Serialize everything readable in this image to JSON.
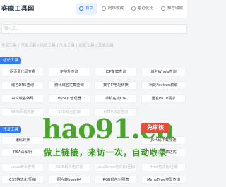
{
  "header": {
    "brand": "客鹿工具网",
    "nav": [
      {
        "label": "首页",
        "active": true
      },
      {
        "label": "网络收藏",
        "active": false
      },
      {
        "label": "最近使用",
        "active": false
      },
      {
        "label": "推荐收藏",
        "active": false
      }
    ]
  },
  "search": {
    "placeholder": "输入工..."
  },
  "breadcrumbs": "全部工具 | 开发工具 | 站长工具 | 文本工具 | 加密工具 | 其他工具",
  "sections": [
    {
      "label": "站长工具"
    },
    {
      "label": "开发工具"
    }
  ],
  "tools_site": [
    [
      "网页源代码查看",
      "IP地址查询",
      "ICP备案查询",
      "域名Whois查询"
    ],
    [
      "域名DNS查询",
      "腾讯域名拦截查询",
      "数字IP地址转换",
      "网站Favicon获取"
    ],
    [
      "中文域名转码",
      "MySQL管理器",
      "手机在线FTP",
      "重发HTTP请求"
    ],
    [
      "PING网站测速",
      "SEO综合查询",
      "HTTP状态查询",
      ""
    ]
  ],
  "tools_dev": [
    [
      "编码转换",
      "",
      "",
      "JS代码下载加速"
    ],
    [
      "RSA公私钥",
      "",
      "",
      "在线正则表达式"
    ],
    [
      "Linux命令查询",
      "JSON解析格式化",
      "JavaScript格式化/压缩",
      "Html格式化/压缩"
    ],
    [
      "CSS格式化/压缩",
      "图片转base64",
      "RGB颜色对照表",
      "MimeType类型查询"
    ]
  ],
  "watermark": {
    "logo": "hao91.cn",
    "badge": "免审核",
    "slogan": "做上链接，来访一次，自动收录"
  },
  "colors": {
    "accent": "#2f7cf6",
    "watermark_green": "#4aa52c",
    "badge_red": "#e94b3c"
  }
}
